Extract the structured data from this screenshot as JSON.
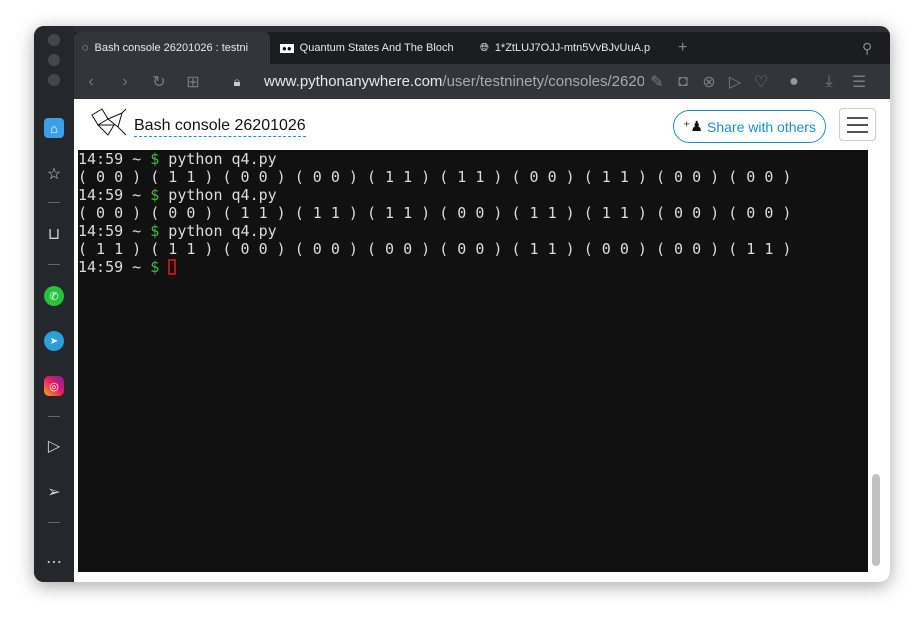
{
  "browser": {
    "tabs": [
      {
        "label": "Bash console 26201026 : testni",
        "icon": "pythonanywhere-icon",
        "active": true
      },
      {
        "label": "Quantum States And The Bloch",
        "icon": "medium-icon"
      },
      {
        "label": "1*ZtLUJ7OJJ-mtn5VvBJvUuA.p",
        "icon": "globe-icon"
      }
    ],
    "url_domain": "www.pythonanywhere.com",
    "url_path": "/user/testninety/consoles/2620"
  },
  "sidebar": {
    "items": [
      "home",
      "bookmarks",
      "shopping-bag",
      "whatsapp",
      "telegram",
      "instagram",
      "player",
      "send",
      "more"
    ]
  },
  "header": {
    "title": "Bash console 26201026",
    "share_label": "Share with others"
  },
  "terminal": {
    "prompt": "14:59 ~ ",
    "dollar": "$",
    "lines": [
      {
        "cmd": " python q4.py",
        "out": "( 0 0 ) ( 1 1 ) ( 0 0 ) ( 0 0 ) ( 1 1 ) ( 1 1 ) ( 0 0 ) ( 1 1 ) ( 0 0 ) ( 0 0 )"
      },
      {
        "cmd": " python q4.py",
        "out": "( 0 0 ) ( 0 0 ) ( 1 1 ) ( 1 1 ) ( 1 1 ) ( 0 0 ) ( 1 1 ) ( 1 1 ) ( 0 0 ) ( 0 0 )"
      },
      {
        "cmd": " python q4.py",
        "out": "( 1 1 ) ( 1 1 ) ( 0 0 ) ( 0 0 ) ( 0 0 ) ( 0 0 ) ( 1 1 ) ( 0 0 ) ( 0 0 ) ( 1 1 )"
      }
    ]
  },
  "colors": {
    "accent": "#1a8fd0",
    "prompt_green": "#3fbf3f",
    "cursor": "#b01818"
  }
}
